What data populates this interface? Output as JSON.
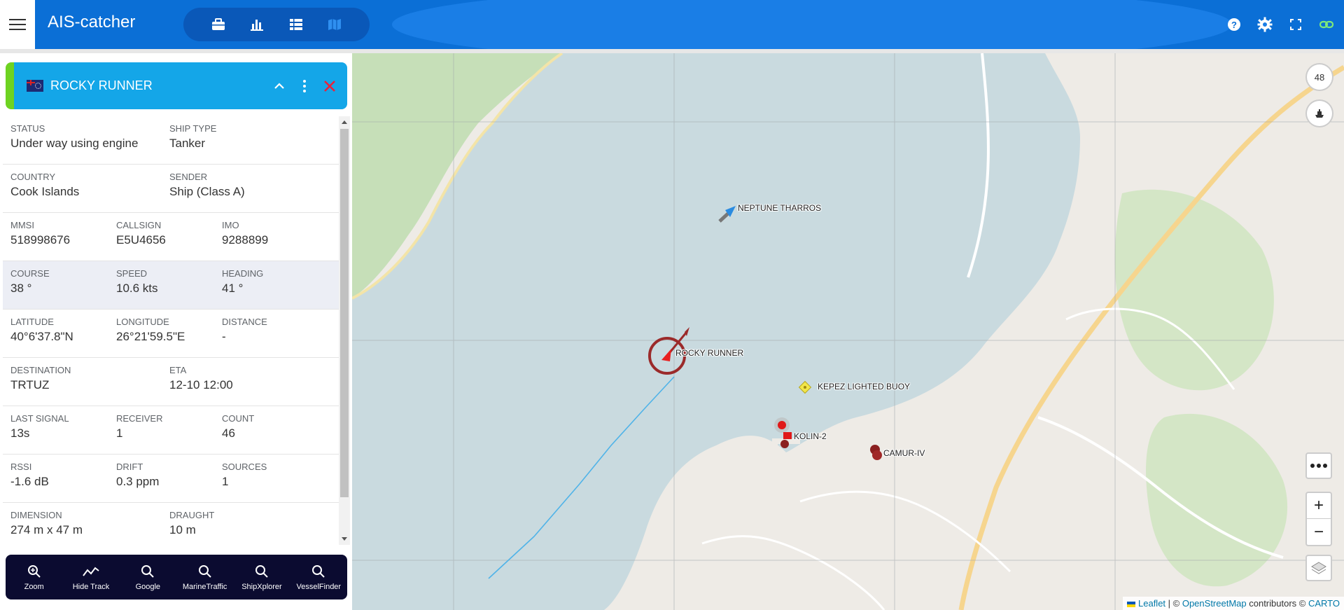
{
  "app": {
    "title": "AIS-catcher"
  },
  "nav": {
    "items": [
      "briefcase-icon",
      "bar-chart-icon",
      "list-icon",
      "map-icon"
    ],
    "active": "map-icon"
  },
  "header_right": {
    "icons": [
      "help-icon",
      "gear-icon",
      "fullscreen-icon",
      "link-icon"
    ]
  },
  "ship": {
    "name": "ROCKY RUNNER",
    "flag": "Cook Islands",
    "accent_color": "#6ed321",
    "bar_color": "#14a6e8"
  },
  "details": {
    "status": {
      "label": "STATUS",
      "value": "Under way using engine"
    },
    "ship_type": {
      "label": "SHIP TYPE",
      "value": "Tanker"
    },
    "country": {
      "label": "COUNTRY",
      "value": "Cook Islands"
    },
    "sender": {
      "label": "SENDER",
      "value": "Ship (Class A)"
    },
    "mmsi": {
      "label": "MMSI",
      "value": "518998676"
    },
    "callsign": {
      "label": "CALLSIGN",
      "value": "E5U4656"
    },
    "imo": {
      "label": "IMO",
      "value": "9288899"
    },
    "course": {
      "label": "COURSE",
      "value": "38 °"
    },
    "speed": {
      "label": "SPEED",
      "value": "10.6 kts"
    },
    "heading": {
      "label": "HEADING",
      "value": "41 °"
    },
    "latitude": {
      "label": "LATITUDE",
      "value": "40°6'37.8\"N"
    },
    "longitude": {
      "label": "LONGITUDE",
      "value": "26°21'59.5\"E"
    },
    "distance": {
      "label": "DISTANCE",
      "value": "-"
    },
    "destination": {
      "label": "DESTINATION",
      "value": "TRTUZ"
    },
    "eta": {
      "label": "ETA",
      "value": "12-10 12:00"
    },
    "last_signal": {
      "label": "LAST SIGNAL",
      "value": "13s"
    },
    "receiver": {
      "label": "RECEIVER",
      "value": "1"
    },
    "count": {
      "label": "COUNT",
      "value": "46"
    },
    "rssi": {
      "label": "RSSI",
      "value": "-1.6 dB"
    },
    "drift": {
      "label": "DRIFT",
      "value": "0.3 ppm"
    },
    "sources": {
      "label": "SOURCES",
      "value": "1"
    },
    "dimension": {
      "label": "DIMENSION",
      "value": "274 m x 47 m"
    },
    "draught": {
      "label": "DRAUGHT",
      "value": "10 m"
    }
  },
  "actions": [
    {
      "label": "Zoom",
      "icon": "zoom-icon"
    },
    {
      "label": "Hide Track",
      "icon": "track-icon"
    },
    {
      "label": "Google",
      "icon": "search-icon"
    },
    {
      "label": "MarineTraffic",
      "icon": "search-icon"
    },
    {
      "label": "ShipXplorer",
      "icon": "search-icon"
    },
    {
      "label": "VesselFinder",
      "icon": "search-icon"
    }
  ],
  "map": {
    "count_badge": "48",
    "labels": {
      "neptune": "NEPTUNE THARROS",
      "rocky": "ROCKY RUNNER",
      "kepez": "KEPEZ LIGHTED BUOY",
      "kolin": "KOLIN-2",
      "camur": "CAMUR-IV"
    },
    "zoom_in": "+",
    "zoom_out": "−",
    "attribution": {
      "leaflet": "Leaflet",
      "sep": " | © ",
      "osm": "OpenStreetMap",
      "contrib": " contributors © ",
      "carto": "CARTO"
    },
    "colors": {
      "water": "#c9dadf",
      "land": "#eeebe6",
      "green": "#c6dfb8",
      "road": "#f6d58e"
    }
  }
}
